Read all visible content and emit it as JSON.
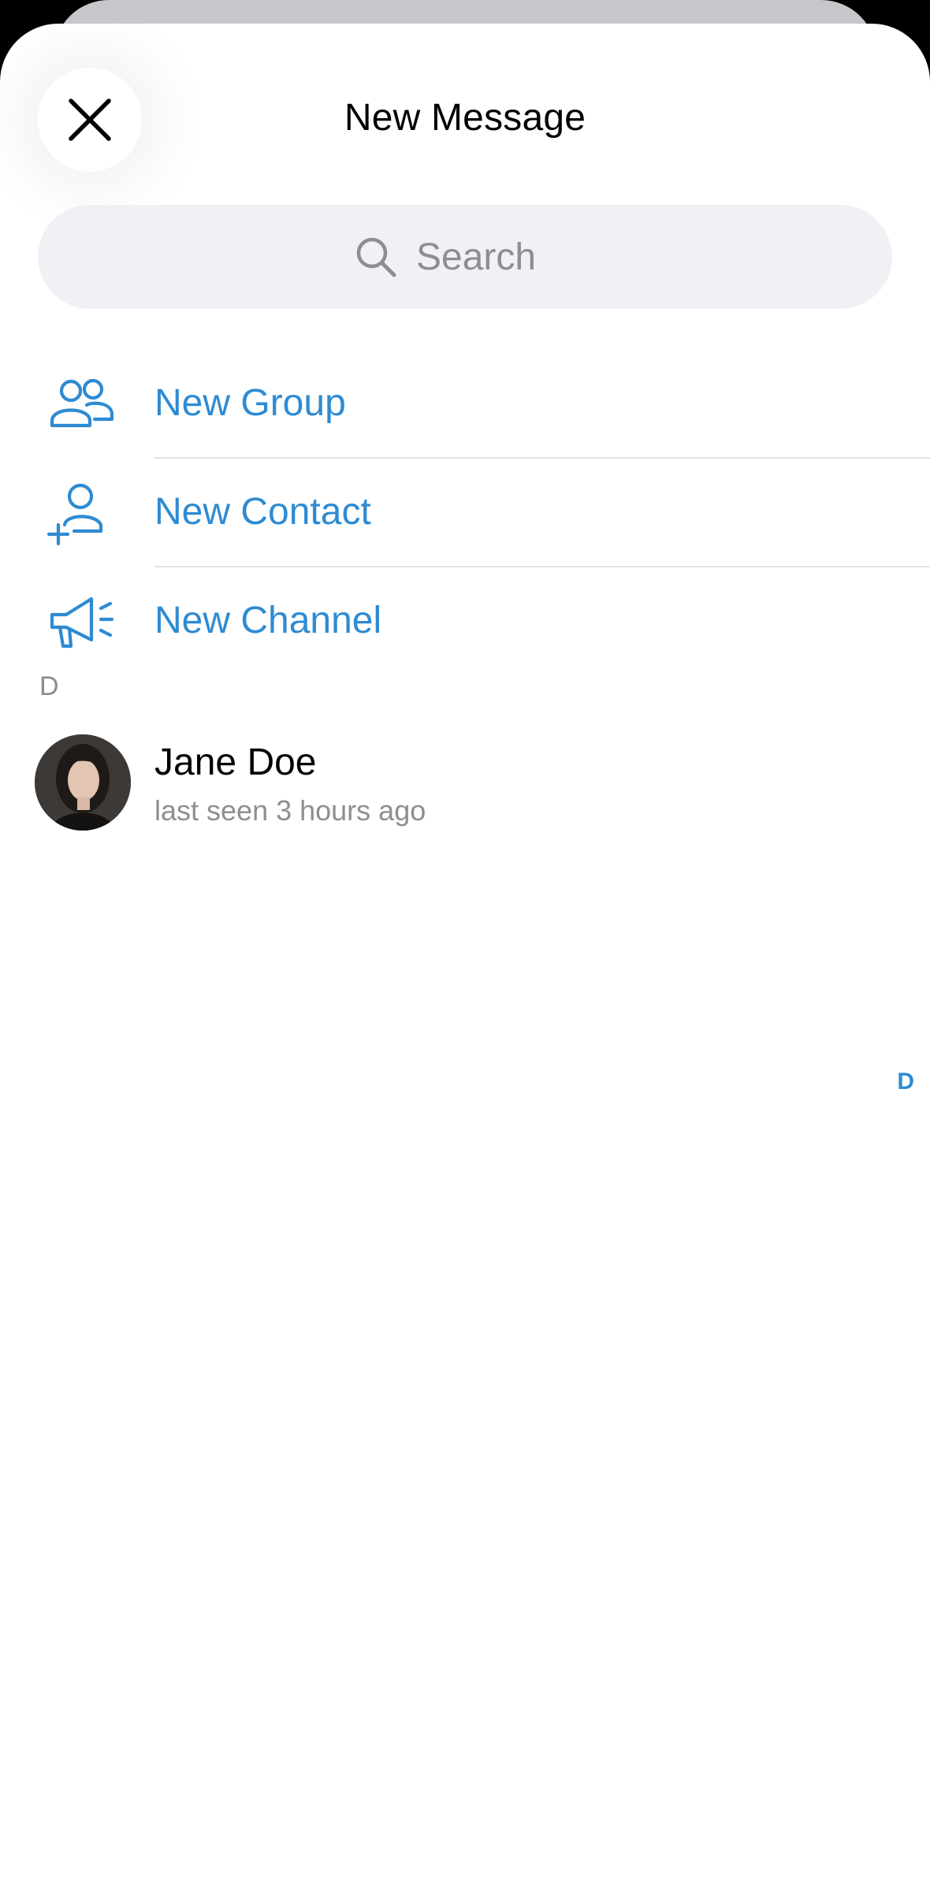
{
  "header": {
    "title": "New Message",
    "close_icon": "close-icon"
  },
  "search": {
    "placeholder": "Search",
    "icon": "search-icon"
  },
  "actions": [
    {
      "label": "New Group",
      "icon": "group-icon"
    },
    {
      "label": "New Contact",
      "icon": "add-contact-icon"
    },
    {
      "label": "New Channel",
      "icon": "megaphone-icon"
    }
  ],
  "contacts": {
    "section_letter": "D",
    "items": [
      {
        "first_name": "Jane",
        "last_name": "Doe",
        "status": "last seen 3 hours ago"
      }
    ]
  },
  "index": {
    "letters": [
      "D"
    ]
  },
  "colors": {
    "accent": "#2e8bd2",
    "secondary_text": "#8e8e93",
    "search_bg": "#f1f0f5",
    "divider": "#e1e1e4"
  }
}
